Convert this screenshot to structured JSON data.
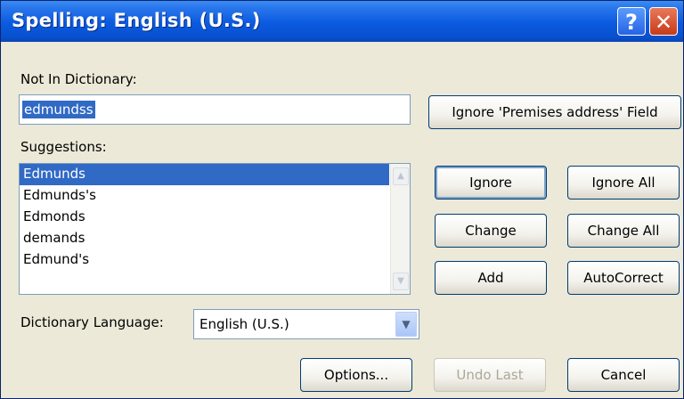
{
  "window": {
    "title": "Spelling: English (U.S.)",
    "help_glyph": "?",
    "close_glyph": "✕"
  },
  "not_in_dictionary": {
    "label": "Not In Dictionary:",
    "value": "edmundss"
  },
  "ignore_field_button": "Ignore 'Premises address' Field",
  "suggestions": {
    "label": "Suggestions:",
    "items": [
      "Edmunds",
      "Edmunds's",
      "Edmonds",
      "demands",
      "Edmund's"
    ],
    "selected_index": 0
  },
  "buttons": {
    "ignore": "Ignore",
    "ignore_all": "Ignore All",
    "change": "Change",
    "change_all": "Change All",
    "add": "Add",
    "autocorrect": "AutoCorrect",
    "options": "Options...",
    "undo_last": "Undo Last",
    "cancel": "Cancel"
  },
  "dictionary_language": {
    "label": "Dictionary Language:",
    "value": "English (U.S.)"
  },
  "colors": {
    "titlebar": "#0a5ae0",
    "selection": "#316ac5",
    "dialog_bg": "#ece9d8"
  }
}
